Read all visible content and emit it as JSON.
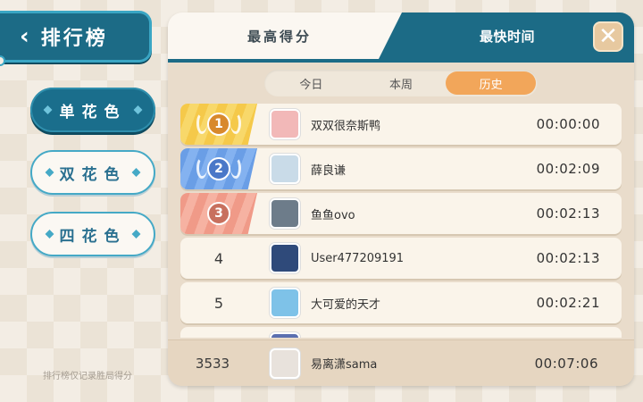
{
  "header": {
    "back_label": "排行榜"
  },
  "modes": [
    {
      "label": "单花色",
      "active": true
    },
    {
      "label": "双花色",
      "active": false
    },
    {
      "label": "四花色",
      "active": false
    }
  ],
  "footnote": "排行榜仅记录胜局得分",
  "tabs": {
    "score_label": "最高得分",
    "time_label": "最快时间"
  },
  "periods": [
    {
      "label": "今日",
      "selected": false
    },
    {
      "label": "本周",
      "selected": false
    },
    {
      "label": "历史",
      "selected": true
    }
  ],
  "leaderboard": [
    {
      "rank": "1",
      "name": "双双很奈斯鸭",
      "time": "00:00:00",
      "avatar_color": "#f2b8b8"
    },
    {
      "rank": "2",
      "name": "薛良谦",
      "time": "00:02:09",
      "avatar_color": "#c9dbe8"
    },
    {
      "rank": "3",
      "name": "鱼鱼ovo",
      "time": "00:02:13",
      "avatar_color": "#6d7c8a"
    },
    {
      "rank": "4",
      "name": "User477209191",
      "time": "00:02:13",
      "avatar_color": "#2f4a7a"
    },
    {
      "rank": "5",
      "name": "大可爱的天才",
      "time": "00:02:21",
      "avatar_color": "#7ec2e8"
    }
  ],
  "me": {
    "rank": "3533",
    "name": "易离潇sama",
    "time": "00:07:06",
    "avatar_color": "#e8e2dc"
  },
  "colors": {
    "primary": "#1c6b86",
    "accent": "#f2a65a",
    "gold": "#f5c94a",
    "silver": "#6a9ee6",
    "bronze": "#f09a88"
  }
}
